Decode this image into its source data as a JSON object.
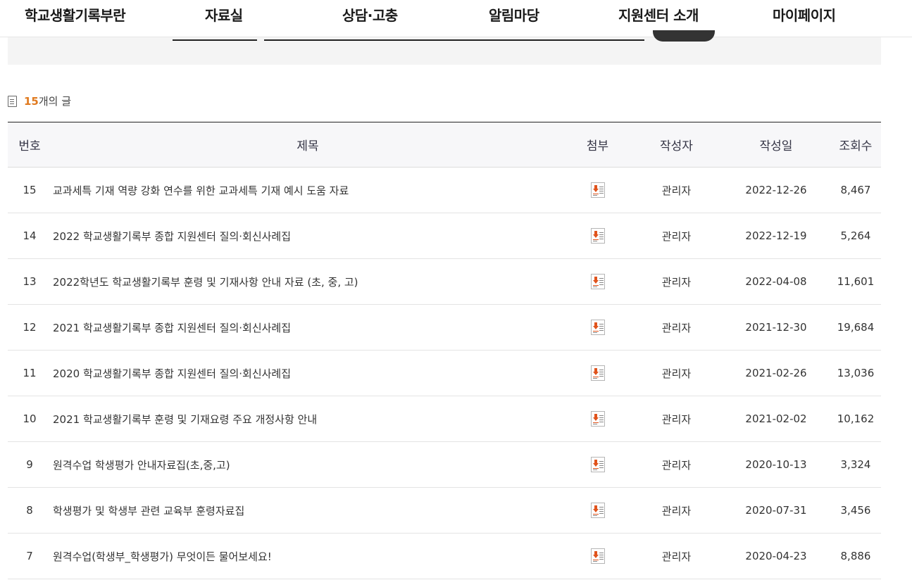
{
  "nav": {
    "items": [
      "학교생활기록부란",
      "자료실",
      "상담·고충",
      "알림마당",
      "지원센터 소개",
      "마이페이지"
    ]
  },
  "count": {
    "value": "15",
    "suffix": "개의 글"
  },
  "table": {
    "headers": [
      "번호",
      "제목",
      "첨부",
      "작성자",
      "작성일",
      "조회수"
    ],
    "rows": [
      {
        "no": "15",
        "title": "교과세특 기재 역량 강화 연수를 위한 교과세특 기재 예시 도움 자료",
        "author": "관리자",
        "date": "2022-12-26",
        "views": "8,467"
      },
      {
        "no": "14",
        "title": "2022 학교생활기록부 종합 지원센터 질의·회신사례집",
        "author": "관리자",
        "date": "2022-12-19",
        "views": "5,264"
      },
      {
        "no": "13",
        "title": "2022학년도 학교생활기록부 훈령 및 기재사항 안내 자료 (초, 중, 고)",
        "author": "관리자",
        "date": "2022-04-08",
        "views": "11,601"
      },
      {
        "no": "12",
        "title": "2021 학교생활기록부 종합 지원센터 질의·회신사례집",
        "author": "관리자",
        "date": "2021-12-30",
        "views": "19,684"
      },
      {
        "no": "11",
        "title": "2020 학교생활기록부 종합 지원센터 질의·회신사례집",
        "author": "관리자",
        "date": "2021-02-26",
        "views": "13,036"
      },
      {
        "no": "10",
        "title": "2021 학교생활기록부 훈령 및 기재요령 주요 개정사항 안내",
        "author": "관리자",
        "date": "2021-02-02",
        "views": "10,162"
      },
      {
        "no": "9",
        "title": "원격수업 학생평가 안내자료집(초,중,고)",
        "author": "관리자",
        "date": "2020-10-13",
        "views": "3,324"
      },
      {
        "no": "8",
        "title": "학생평가 및 학생부 관련 교육부 훈령자료집",
        "author": "관리자",
        "date": "2020-07-31",
        "views": "3,456"
      },
      {
        "no": "7",
        "title": "원격수업(학생부_학생평가) 무엇이든 물어보세요!",
        "author": "관리자",
        "date": "2020-04-23",
        "views": "8,886"
      }
    ]
  },
  "icons": {
    "count": "document-icon",
    "attachment": "file-download-icon"
  },
  "colors": {
    "accent": "#e07a1f",
    "attachment_arrow": "#e0531c"
  }
}
